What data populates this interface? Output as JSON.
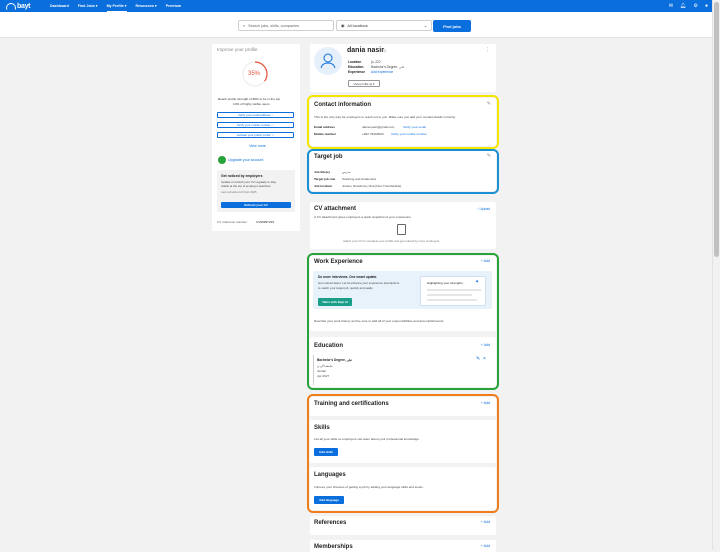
{
  "nav": {
    "logo": "bayt",
    "links": [
      "Dashboard",
      "Find Jobs ▾",
      "My Profile ▾",
      "Resources ▾",
      "Premium"
    ],
    "active_index": 2,
    "icons": [
      "chat-icon",
      "bell-icon",
      "settings-icon",
      "user-icon"
    ]
  },
  "search": {
    "placeholder": "Search jobs, skills, companies",
    "location": "All locations",
    "button": "Find jobs"
  },
  "sidebar": {
    "title": "Improve your profile",
    "percent": "35%",
    "strength_text": "Reach profile strength of 80% to be in the top",
    "strength_text2": "10% of highly visible users.",
    "buttons": [
      "Verify your email address ↑",
      "Verify your mobile number ↑↑",
      "Activate your public profile ↑↑"
    ],
    "view_more": "View more",
    "upgrade": "Upgrade your account",
    "noticed_title": "Get noticed by employers",
    "noticed_text": [
      "Update or refresh your CV regularly to stay",
      "visible at the top of employer searches.",
      "Last refreshed 24 Feb 2025"
    ],
    "refresh_button": "Refresh your CV",
    "ref_label": "CV reference number:",
    "ref_value": "CV99997245"
  },
  "profile": {
    "name": "dania nasir",
    "rows": [
      {
        "k": "Location",
        "v": "jo, 222"
      },
      {
        "k": "Education",
        "v": "Bachelor's Degree, علي"
      },
      {
        "k": "Experience",
        "v": "Add experience"
      }
    ],
    "action": "View profile as ▾"
  },
  "contact": {
    "title": "Contact information",
    "note": "This is the only way for employers to reach out to you. Make sure you add your contact details correctly.",
    "rows": [
      {
        "k": "Email address",
        "v": "dania.nasir@gmail.com",
        "link": "Verify your email"
      },
      {
        "k": "Mobile number",
        "v": "+962 79000000",
        "link": "Verify your mobile number"
      }
    ]
  },
  "target": {
    "title": "Target job",
    "rows": [
      {
        "k": "Job title(s)",
        "v": "مدرس"
      },
      {
        "k": "Target job role",
        "v": "Teaching and Academics"
      },
      {
        "k": "Job location",
        "v": "Jordan, Residency Visa (Non-Transferable)"
      }
    ]
  },
  "cv": {
    "title": "CV attachment",
    "upload": "↑ Upload",
    "desc": "A CV attachment gives employers a quick snapshot of your experience.",
    "hint": "Attach your CV to complete your profile and get noticed by more employers"
  },
  "work": {
    "title": "Work Experience",
    "add": "+ Add",
    "promo_title": "Do more interviews. One smart update.",
    "promo_text": [
      "Get noticed faster. Let AI enhance your experience descriptions",
      "to match your target job, quickly and easily."
    ],
    "promo_button": "Tailor with Bayt AI",
    "promo_side": "Highlighting your strengths...",
    "desc": "Describe your work history and be sure to add all of your responsibilities and accomplishments."
  },
  "education": {
    "title": "Education",
    "add": "+ Add",
    "entry": [
      "Bachelor's Degree, علي",
      "جامعة الأردن",
      "Jordan",
      "Apr 2027"
    ]
  },
  "training": {
    "title": "Training and certifications",
    "add": "+ Add"
  },
  "skills": {
    "title": "Skills",
    "desc": "List all your skills so employers can learn about your professional knowledge.",
    "button": "Add skills"
  },
  "languages": {
    "title": "Languages",
    "desc": "Improve your chances of getting a job by adding your language skills and levels.",
    "button": "Add language"
  },
  "references": {
    "title": "References",
    "add": "+ Add"
  },
  "memberships": {
    "title": "Memberships",
    "add": "+ Add"
  },
  "colors": {
    "brand": "#0a6edc",
    "highlight_yellow": "#f5e600",
    "highlight_blue": "#1a8fd1",
    "highlight_green": "#27a33a",
    "highlight_orange": "#f07c1b",
    "progress": "#e8503a"
  }
}
